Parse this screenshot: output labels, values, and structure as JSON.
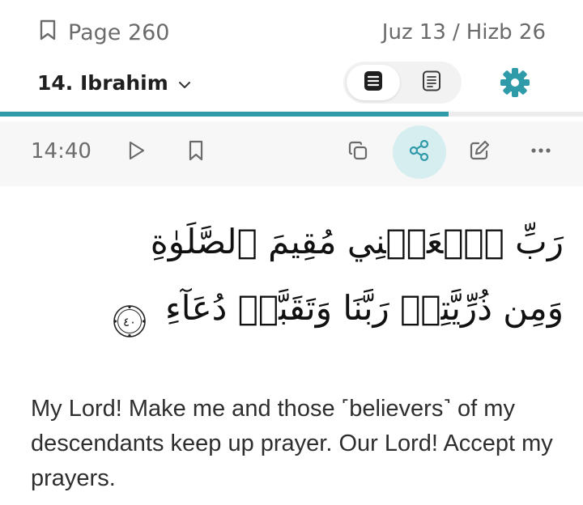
{
  "header": {
    "page_label": "Page 260",
    "juz_label": "Juz 13",
    "separator": "/",
    "hizb_label": "Hizb 26"
  },
  "surah": {
    "name": "14. Ibrahim"
  },
  "reading_progress": 0.77,
  "verse": {
    "key": "14:40",
    "arabic": "رَبِّ ٱجۡعَلۡنِي مُقِيمَ ٱلصَّلَوٰةِ وَمِن ذُرِّيَّتِيۚ رَبَّنَا وَتَقَبَّلۡ دُعَآءِ",
    "ayah_number": "٤٠",
    "translation": "My Lord! Make me and those ˹believers˺ of my descendants keep up prayer. Our Lord! Accept my prayers."
  },
  "icons": {
    "bookmark_header": "bookmark-outline-icon",
    "chevron": "chevron-down-icon",
    "mode_translation": "list-icon",
    "mode_reading": "page-icon",
    "settings": "gear-icon",
    "play": "play-icon",
    "bookmark": "bookmark-icon",
    "copy": "copy-icon",
    "share": "share-icon",
    "note": "edit-note-icon",
    "more": "more-icon"
  },
  "colors": {
    "accent": "#2f9aa8",
    "accent_soft": "#d7eef1",
    "muted_text": "#6b6b6b"
  }
}
